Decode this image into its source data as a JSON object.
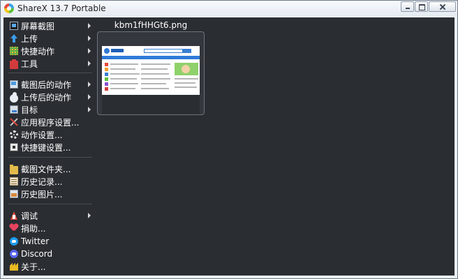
{
  "window": {
    "title": "ShareX 13.7 Portable"
  },
  "menu": {
    "items": [
      {
        "label": "屏幕截图",
        "icon": "screen-capture-icon",
        "submenu": true
      },
      {
        "label": "上传",
        "icon": "upload-arrow-icon",
        "submenu": true
      },
      {
        "label": "快捷动作",
        "icon": "workflows-dots-icon",
        "submenu": true
      },
      {
        "label": "工具",
        "icon": "toolbox-icon",
        "submenu": true
      },
      {
        "label": "截图后的动作",
        "icon": "after-capture-icon",
        "submenu": true
      },
      {
        "label": "上传后的动作",
        "icon": "after-upload-cloud-icon",
        "submenu": true
      },
      {
        "label": "目标",
        "icon": "destinations-icon",
        "submenu": true
      },
      {
        "label": "应用程序设置...",
        "icon": "application-settings-icon",
        "submenu": false
      },
      {
        "label": "动作设置...",
        "icon": "task-settings-gear-icon",
        "submenu": false
      },
      {
        "label": "快捷键设置...",
        "icon": "hotkey-settings-icon",
        "submenu": false
      },
      {
        "label": "截图文件夹...",
        "icon": "screenshots-folder-icon",
        "submenu": false
      },
      {
        "label": "历史记录...",
        "icon": "history-icon",
        "submenu": false
      },
      {
        "label": "历史图片...",
        "icon": "image-history-icon",
        "submenu": false
      },
      {
        "label": "调试",
        "icon": "debug-icon",
        "submenu": true
      },
      {
        "label": "捐助...",
        "icon": "donate-heart-icon",
        "submenu": false
      },
      {
        "label": "Twitter",
        "icon": "twitter-icon",
        "submenu": false
      },
      {
        "label": "Discord",
        "icon": "discord-icon",
        "submenu": false
      },
      {
        "label": "关于...",
        "icon": "about-crown-icon",
        "submenu": false
      }
    ]
  },
  "thumbnail": {
    "filename": "kbm1fHHGt6.png"
  },
  "colors": {
    "background": "#2a2d32",
    "text": "#ffffff",
    "border": "#6f747c"
  }
}
